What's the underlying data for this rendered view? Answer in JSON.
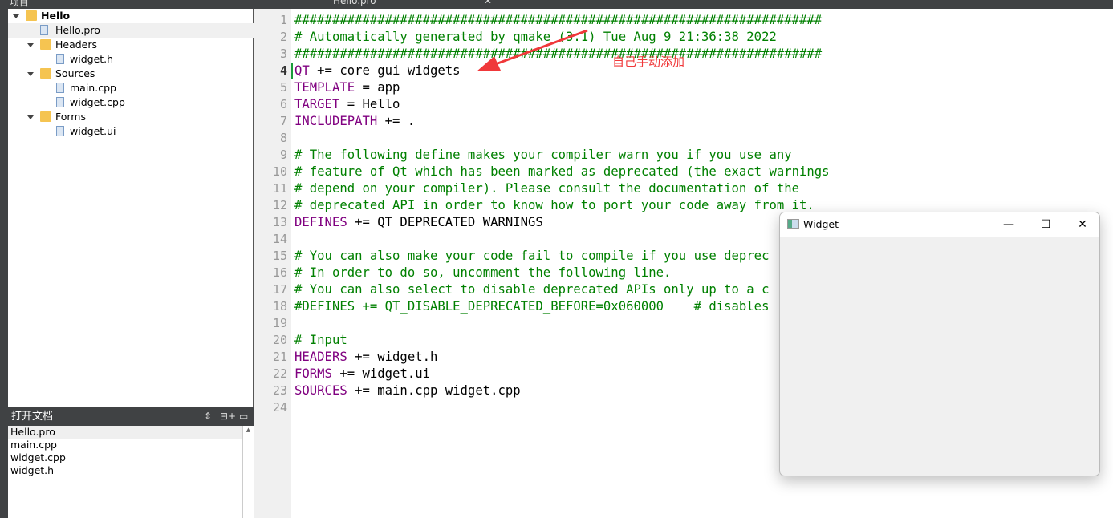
{
  "topbar": {
    "panel_title": "项目",
    "tab_file": "Hello.pro"
  },
  "tree": [
    {
      "label": "Hello",
      "level": 0,
      "arrow": true,
      "icon": "qt-project-folder-icon",
      "bold": true
    },
    {
      "label": "Hello.pro",
      "level": 1,
      "arrow": false,
      "icon": "pro-file-icon",
      "selected": true
    },
    {
      "label": "Headers",
      "level": 1,
      "arrow": true,
      "icon": "headers-folder-icon"
    },
    {
      "label": "widget.h",
      "level": 2,
      "arrow": false,
      "icon": "header-file-icon"
    },
    {
      "label": "Sources",
      "level": 1,
      "arrow": true,
      "icon": "sources-folder-icon"
    },
    {
      "label": "main.cpp",
      "level": 2,
      "arrow": false,
      "icon": "cpp-file-icon"
    },
    {
      "label": "widget.cpp",
      "level": 2,
      "arrow": false,
      "icon": "cpp-file-icon"
    },
    {
      "label": "Forms",
      "level": 1,
      "arrow": true,
      "icon": "forms-folder-icon"
    },
    {
      "label": "widget.ui",
      "level": 2,
      "arrow": false,
      "icon": "ui-file-icon"
    }
  ],
  "open_docs": {
    "title": "打开文档",
    "items": [
      "Hello.pro",
      "main.cpp",
      "widget.cpp",
      "widget.h"
    ]
  },
  "editor": {
    "current_line": 4,
    "lines": [
      [
        [
          "cm",
          "######################################################################"
        ]
      ],
      [
        [
          "cm",
          "# Automatically generated by qmake (3.1) Tue Aug 9 21:36:38 2022"
        ]
      ],
      [
        [
          "cm",
          "######################################################################"
        ]
      ],
      [
        [
          "kw",
          "QT"
        ],
        [
          "p",
          " += core gui widgets"
        ]
      ],
      [
        [
          "kw",
          "TEMPLATE"
        ],
        [
          "p",
          " = app"
        ]
      ],
      [
        [
          "kw",
          "TARGET"
        ],
        [
          "p",
          " = Hello"
        ]
      ],
      [
        [
          "kw",
          "INCLUDEPATH"
        ],
        [
          "p",
          " += ."
        ]
      ],
      [],
      [
        [
          "cm",
          "# The following define makes your compiler warn you if you use any"
        ]
      ],
      [
        [
          "cm",
          "# feature of Qt which has been marked as deprecated (the exact warnings"
        ]
      ],
      [
        [
          "cm",
          "# depend on your compiler). Please consult the documentation of the"
        ]
      ],
      [
        [
          "cm",
          "# deprecated API in order to know how to port your code away from it."
        ]
      ],
      [
        [
          "kw",
          "DEFINES"
        ],
        [
          "p",
          " += QT_DEPRECATED_WARNINGS"
        ]
      ],
      [],
      [
        [
          "cm",
          "# You can also make your code fail to compile if you use deprec"
        ]
      ],
      [
        [
          "cm",
          "# In order to do so, uncomment the following line."
        ]
      ],
      [
        [
          "cm",
          "# You can also select to disable deprecated APIs only up to a c"
        ]
      ],
      [
        [
          "cm",
          "#DEFINES += QT_DISABLE_DEPRECATED_BEFORE=0x060000    # disables"
        ]
      ],
      [],
      [
        [
          "cm",
          "# Input"
        ]
      ],
      [
        [
          "kw",
          "HEADERS"
        ],
        [
          "p",
          " += widget.h"
        ]
      ],
      [
        [
          "kw",
          "FORMS"
        ],
        [
          "p",
          " += widget.ui"
        ]
      ],
      [
        [
          "kw",
          "SOURCES"
        ],
        [
          "p",
          " += main.cpp widget.cpp"
        ]
      ],
      []
    ]
  },
  "annotation": {
    "text": "自己手动添加",
    "color": "#f0383a"
  },
  "widget_window": {
    "title": "Widget",
    "minimize": "—",
    "maximize": "☐",
    "close": "✕"
  }
}
